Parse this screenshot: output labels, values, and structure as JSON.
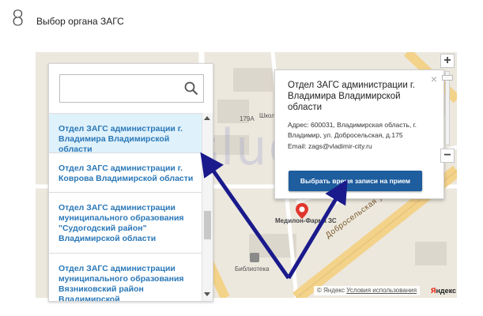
{
  "step": {
    "number": "8",
    "title": "Выбор органа ЗАГС"
  },
  "watermark": "Gosuslugid.ru",
  "search": {
    "value": "",
    "placeholder": ""
  },
  "offices": [
    {
      "name": "Отдел ЗАГС администрации г. Владимира Владимирской области",
      "selected": true
    },
    {
      "name": "Отдел ЗАГС администрации г. Коврова Владимирской области"
    },
    {
      "name": "Отдел ЗАГС администрации муниципального образования \"Судогодский район\" Владимирской области"
    },
    {
      "name": "Отдел ЗАГС администрации муниципального образования Вязниковский район Владимирской"
    }
  ],
  "popup": {
    "title": "Отдел ЗАГС администрации г. Владимира Владимирской области",
    "address": "Адрес: 600031, Владимирская область, г. Владимир, ул. Добросельская, д.175",
    "email": "Email: zags@vladimir-city.ru",
    "button": "Выбрать время записи на прием",
    "close": "×"
  },
  "zoom": {
    "plus": "+",
    "minus": "−"
  },
  "map": {
    "labels": {
      "school": "Школ",
      "building": "179А",
      "pharmacy": "Медилон-Фарма",
      "pharmacy_suffix": "ЗС",
      "library": "Библиотека",
      "street_main": "Добросельская ул.",
      "street_cross": "ро"
    },
    "copyright": {
      "owner": "© Яндекс",
      "terms": "Условия использования"
    },
    "logo": {
      "first": "Я",
      "rest": "ндекс"
    }
  },
  "colors": {
    "accent": "#1e5d9e",
    "link": "#2a78b8",
    "selected_bg": "#dff1fb",
    "arrow": "#1a1a8c",
    "road": "#f3d28a"
  }
}
